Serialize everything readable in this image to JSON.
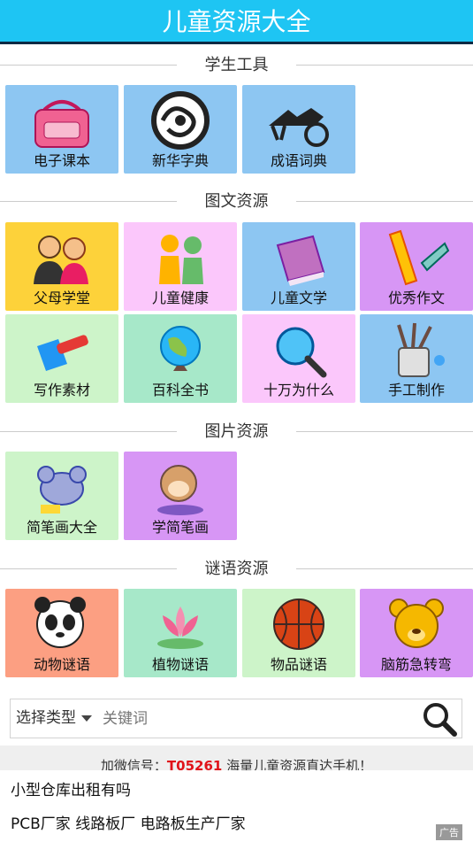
{
  "header": {
    "title": "儿童资源大全"
  },
  "sections": {
    "student_tools": "学生工具",
    "text_resources": "图文资源",
    "picture_resources": "图片资源",
    "riddle_resources": "谜语资源"
  },
  "tiles": {
    "ebook": "电子课本",
    "dictionary": "新华字典",
    "idiom": "成语词典",
    "parents": "父母学堂",
    "health": "儿童健康",
    "literature": "儿童文学",
    "essay": "优秀作文",
    "materials": "写作素材",
    "encyclopedia": "百科全书",
    "why": "十万为什么",
    "craft": "手工制作",
    "stickfig": "简笔画大全",
    "learn_draw": "学简笔画",
    "animal_riddle": "动物谜语",
    "plant_riddle": "植物谜语",
    "object_riddle": "物品谜语",
    "brain_teaser": "脑筋急转弯"
  },
  "tile_colors": {
    "blue": "#8dc6f2",
    "yellow": "#fdd23a",
    "pink": "#fbc7fb",
    "purple": "#d796f5",
    "green": "#cdf4c9",
    "teal": "#a7e8c9",
    "salmon": "#fc9f82"
  },
  "search": {
    "type_label": "选择类型",
    "placeholder": "关键词"
  },
  "promo": {
    "prefix": "加微信号：",
    "code": "T05261",
    "suffix": " 海量儿童资源直达手机！"
  },
  "ad": {
    "line1": "小型仓库出租有吗",
    "line2": "PCB厂家 线路板厂 电路板生产厂家",
    "badge": "广告"
  }
}
